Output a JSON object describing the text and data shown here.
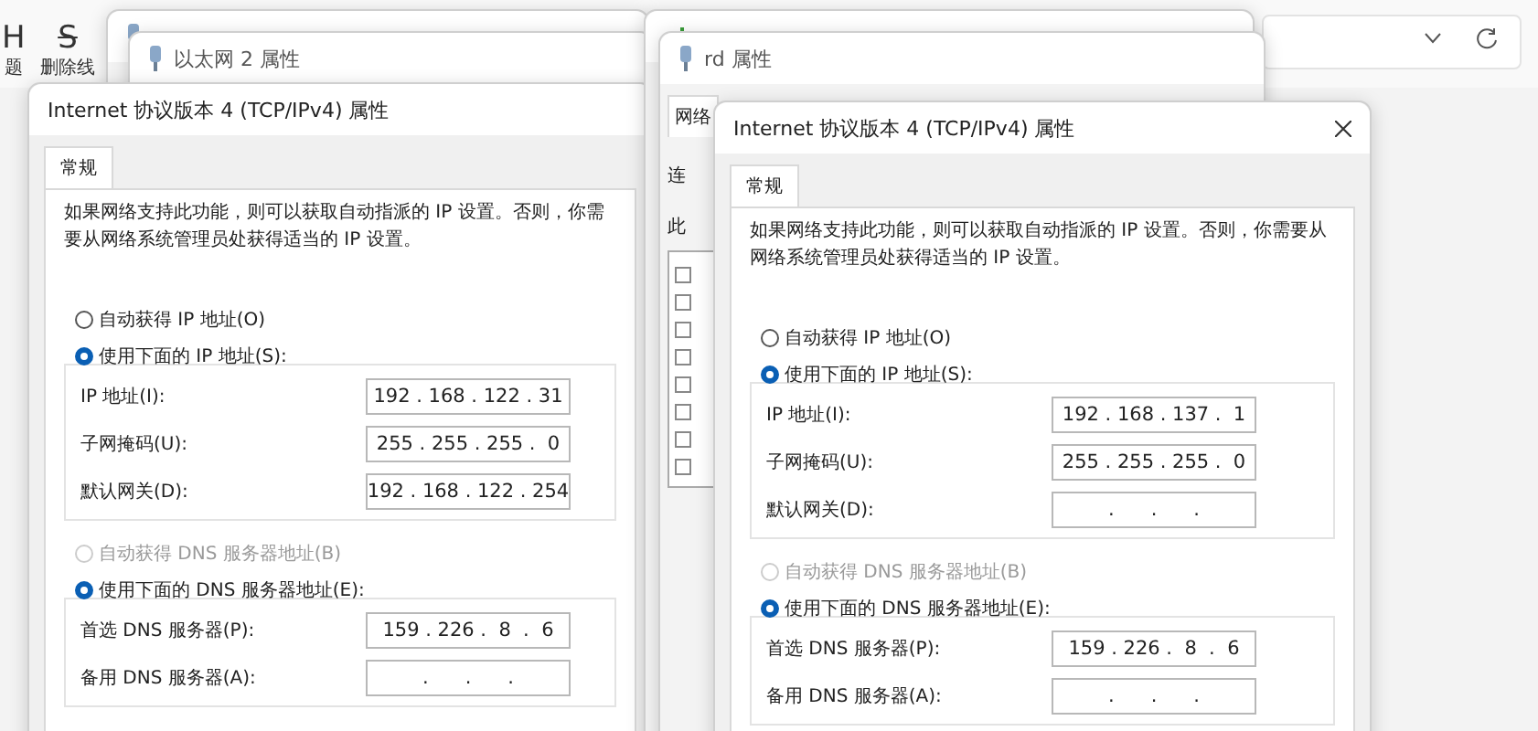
{
  "background_app": {
    "toolbar": [
      {
        "kind": "heading",
        "glyph": "H",
        "label": "题"
      },
      {
        "kind": "strike",
        "glyph": "S",
        "label": "删除线"
      }
    ]
  },
  "stacks": [
    {
      "properties": {
        "title": "以太网 2 属性"
      },
      "dialog": {
        "title": "Internet 协议版本 4 (TCP/IPv4) 属性",
        "tab": "常规",
        "description": "如果网络支持此功能，则可以获取自动指派的 IP 设置。否则，你需要从网络系统管理员处获得适当的 IP 设置。",
        "ip_options": [
          {
            "label": "自动获得 IP 地址(O)",
            "selected": false,
            "disabled": false
          },
          {
            "label": "使用下面的 IP 地址(S):",
            "selected": true,
            "disabled": false
          }
        ],
        "ip_fields": [
          {
            "label": "IP 地址(I):",
            "value": "192 . 168 . 122 . 31"
          },
          {
            "label": "子网掩码(U):",
            "value": "255 . 255 . 255 .  0"
          },
          {
            "label": "默认网关(D):",
            "value": "192 . 168 . 122 . 254"
          }
        ],
        "dns_options": [
          {
            "label": "自动获得 DNS 服务器地址(B)",
            "selected": false,
            "disabled": true
          },
          {
            "label": "使用下面的 DNS 服务器地址(E):",
            "selected": true,
            "disabled": false
          }
        ],
        "dns_fields": [
          {
            "label": "首选 DNS 服务器(P):",
            "value": "159 . 226 .  8  .  6"
          },
          {
            "label": "备用 DNS 服务器(A):",
            "value": ".      .      ."
          }
        ]
      }
    },
    {
      "properties": {
        "title": "rd 属性",
        "tab": "网络",
        "labels": [
          "连",
          "此"
        ]
      },
      "dialog": {
        "title": "Internet 协议版本 4 (TCP/IPv4) 属性",
        "close": true,
        "tab": "常规",
        "description": "如果网络支持此功能，则可以获取自动指派的 IP 设置。否则，你需要从网络系统管理员处获得适当的 IP 设置。",
        "ip_options": [
          {
            "label": "自动获得 IP 地址(O)",
            "selected": false,
            "disabled": false
          },
          {
            "label": "使用下面的 IP 地址(S):",
            "selected": true,
            "disabled": false
          }
        ],
        "ip_fields": [
          {
            "label": "IP 地址(I):",
            "value": "192 . 168 . 137 .  1"
          },
          {
            "label": "子网掩码(U):",
            "value": "255 . 255 . 255 .  0"
          },
          {
            "label": "默认网关(D):",
            "value": ".      .      ."
          }
        ],
        "dns_options": [
          {
            "label": "自动获得 DNS 服务器地址(B)",
            "selected": false,
            "disabled": true
          },
          {
            "label": "使用下面的 DNS 服务器地址(E):",
            "selected": true,
            "disabled": false
          }
        ],
        "dns_fields": [
          {
            "label": "首选 DNS 服务器(P):",
            "value": "159 . 226 .  8  .  6"
          },
          {
            "label": "备用 DNS 服务器(A):",
            "value": ".      .      ."
          }
        ]
      }
    }
  ]
}
